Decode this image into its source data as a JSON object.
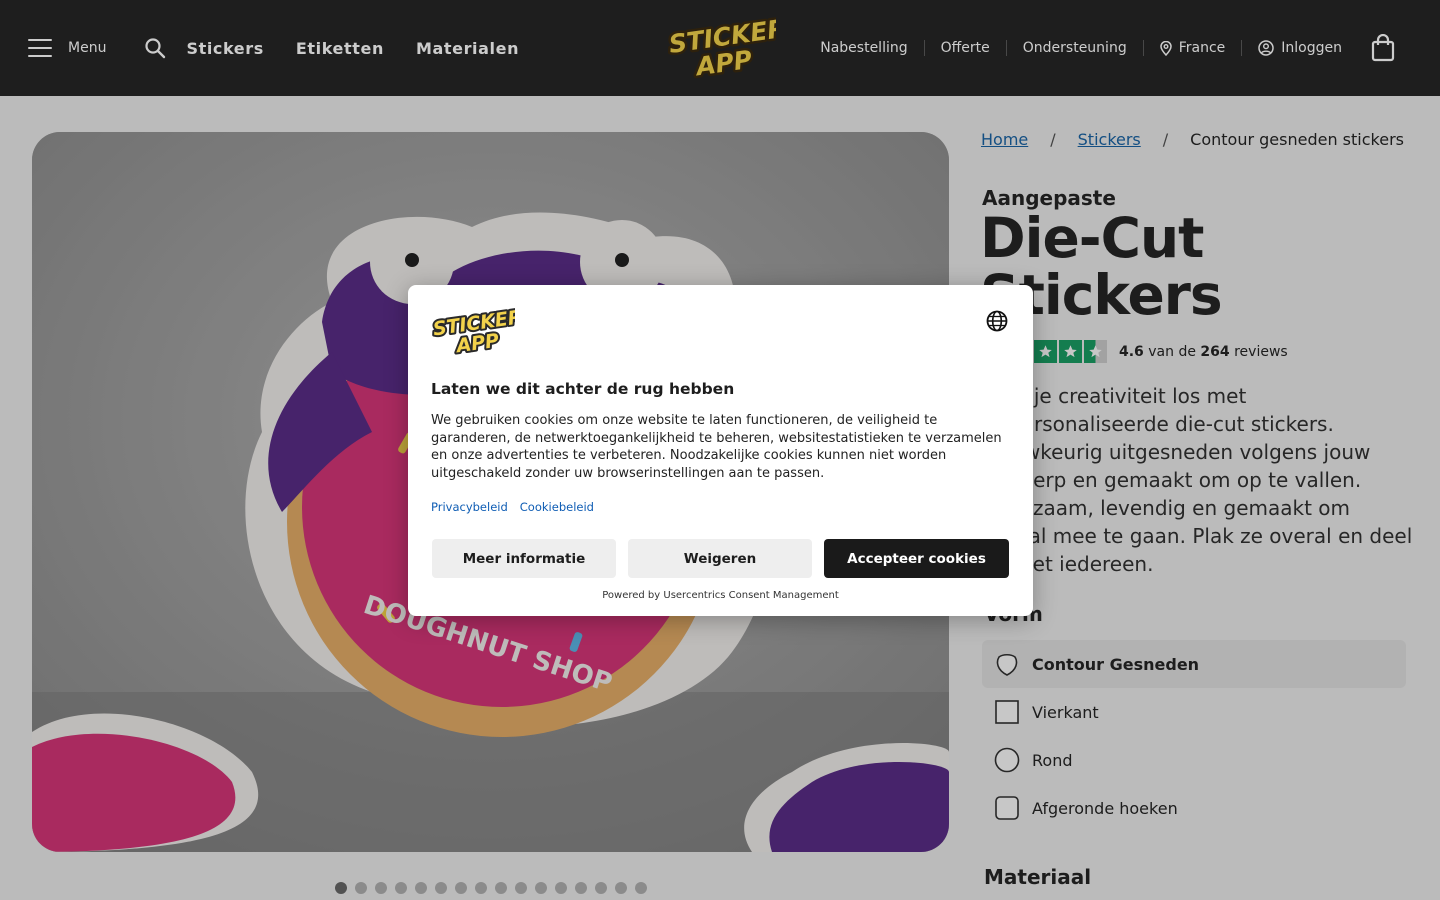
{
  "header": {
    "menu_label": "Menu",
    "nav": [
      "Stickers",
      "Etiketten",
      "Materialen"
    ],
    "logo_text": [
      "STICKER",
      "APP"
    ],
    "util": {
      "reorder": "Nabestelling",
      "quote": "Offerte",
      "support": "Ondersteuning",
      "country": "France",
      "login": "Inloggen"
    }
  },
  "breadcrumb": {
    "home": "Home",
    "stickers": "Stickers",
    "current": "Contour gesneden stickers",
    "separator": "/"
  },
  "product": {
    "pre_title": "Aangepaste",
    "title": "Die-Cut Stickers",
    "rating_score": "4.6",
    "rating_of": "van de",
    "rating_count": "264",
    "rating_suffix": "reviews",
    "description": "Laat je creativiteit los met gepersonaliseerde die-cut stickers. Nauwkeurig uitgesneden volgens jouw ontwerp en gemaakt om op te vallen. Duurzaam, levendig en gemaakt om overal mee te gaan. Plak ze overal en deel ze met iedereen.",
    "shape_title": "Vorm",
    "shapes": [
      "Contour Gesneden",
      "Vierkant",
      "Rond",
      "Afgeronde hoeken"
    ],
    "material_title": "Materiaal"
  },
  "hero_image": {
    "sticker_text": "DOUGHNUT SHOP",
    "carousel_count": 16,
    "carousel_active": 1
  },
  "cookie_modal": {
    "title": "Laten we dit achter de rug hebben",
    "text": "We gebruiken cookies om onze website te laten functioneren, de veiligheid te garanderen, de netwerktoegankelijkheid te beheren, websitestatistieken te verzamelen en onze advertenties te verbeteren. Noodzakelijke cookies kunnen niet worden uitgeschakeld zonder uw browserinstellingen aan te passen.",
    "privacy_link": "Privacybeleid",
    "cookie_link": "Cookiebeleid",
    "more_info": "Meer informatie",
    "decline": "Weigeren",
    "accept": "Accepteer cookies",
    "powered_by": "Powered by Usercentrics Consent Management"
  },
  "colors": {
    "header_bg": "#262626",
    "link_blue": "#1a66a8",
    "trustpilot_green": "#1aa066",
    "accept_button": "#1a1a1a",
    "logo_yellow": "#f2d24b",
    "donut_pink": "#d9367a",
    "mascot_purple": "#5b2d8a"
  },
  "icons": [
    "hamburger-icon",
    "search-icon",
    "location-pin-icon",
    "user-circle-icon",
    "shopping-bag-icon",
    "globe-icon",
    "star-icon",
    "die-cut-shape-icon",
    "square-shape-icon",
    "round-shape-icon",
    "rounded-corner-shape-icon"
  ]
}
